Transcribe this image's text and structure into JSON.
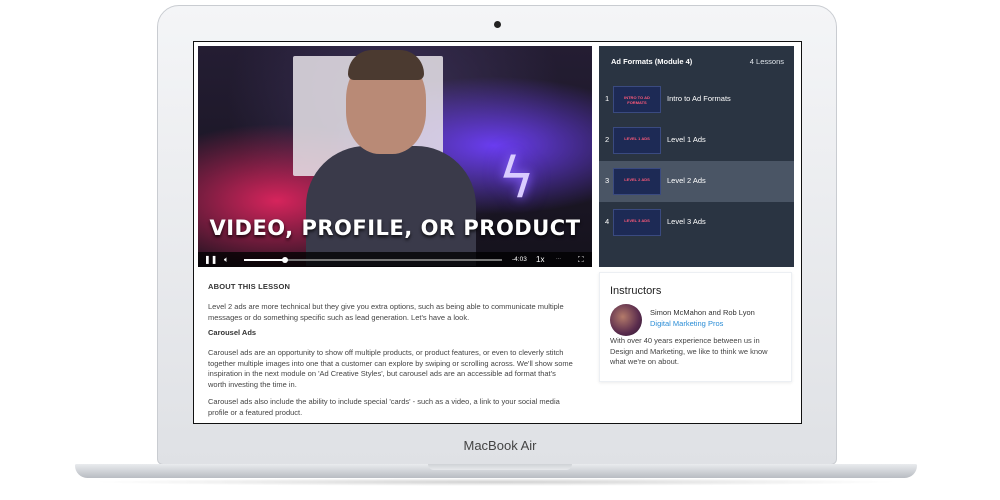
{
  "device": {
    "label": "MacBook Air"
  },
  "video": {
    "caption": "VIDEO, PROFILE, OR PRODUCT",
    "time": "-4:03",
    "speed": "1x",
    "progress_fraction": 0.16
  },
  "playlist": {
    "title": "Ad Formats (Module 4)",
    "count": "4 Lessons",
    "lessons": [
      {
        "num": "1",
        "title": "Intro to Ad Formats",
        "thumb_text": "INTRO TO AD FORMATS"
      },
      {
        "num": "2",
        "title": "Level 1 Ads",
        "thumb_text": "LEVEL 1 ADS"
      },
      {
        "num": "3",
        "title": "Level 2 Ads",
        "thumb_text": "LEVEL 2 ADS"
      },
      {
        "num": "4",
        "title": "Level 3 Ads",
        "thumb_text": "LEVEL 3 ADS"
      }
    ],
    "active_index": 2
  },
  "about": {
    "heading": "ABOUT THIS LESSON",
    "intro": "Level 2 ads are more technical but they give you extra options, such as being able to communicate multiple messages or do something specific such as lead generation. Let's have a look.",
    "subheading": "Carousel Ads",
    "para1": "Carousel ads are an opportunity to show off multiple products, or product features, or even to cleverly stitch together multiple images into one that a customer can explore by swiping or scrolling across. We'll show some inspiration in the next module on 'Ad Creative Styles', but carousel ads are an accessible ad format that's worth investing the time in.",
    "para2": "Carousel ads also include the ability to include special 'cards' - such as a video, a link to your social media profile or a featured product."
  },
  "instructors": {
    "title": "Instructors",
    "names": "Simon McMahon and Rob Lyon",
    "company": "Digital Marketing Pros",
    "bio": "With over 40 years experience between us in Design and Marketing, we like to think we know what we're on about."
  },
  "colors": {
    "playlist_bg": "#2a3442",
    "playlist_active": "#4a5565",
    "link": "#2b8dd6"
  }
}
